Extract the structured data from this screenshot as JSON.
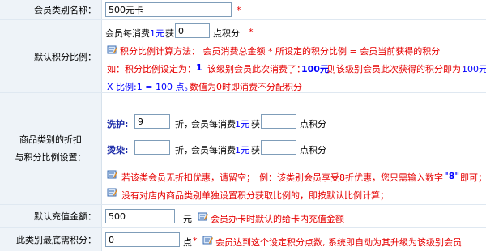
{
  "row1": {
    "label": "会员类别名称：",
    "value": "500元卡",
    "star": "*"
  },
  "row2": {
    "label": "默认积分比例：",
    "text_prefix": "会员每消费",
    "link": "1元",
    "text_mid": "获",
    "value": "0",
    "text_suffix": "点积分",
    "star": "*",
    "line1": "积分比例计算方法： 会员消费总金额 * 所设定的积分比例 = 会员当前获得的积分",
    "line2_a": "如：积分比例设定为：",
    "line2_b": "1",
    "line2_c": "该级别会员此次消费了：",
    "line2_d": "100元",
    "line2_e": "则该级别会员此次获得的积分即为：",
    "line2_f": "100元",
    "line3_a": "X 比例:1 = 100 点。",
    "line3_b": "数值为0时即消费不分配积分"
  },
  "row3": {
    "label_line1": "商品类别的折扣",
    "label_line2": "与积分比例设置：",
    "cat1_name": "洗护:",
    "cat1_discount": "9",
    "cat1_zhe": "折，",
    "cat1_text": "会员每消费",
    "cat1_link": "1元",
    "cat1_get": "获",
    "cat1_points": "",
    "cat1_unit": "点积分",
    "cat2_name": "烫染:",
    "cat2_discount": "",
    "cat2_zhe": "折，",
    "cat2_text": "会员每消费",
    "cat2_link": "1元",
    "cat2_get": "获",
    "cat2_points": "",
    "cat2_unit": "点积分",
    "tip1_a": "若该类会员无折扣优惠，请留空；",
    "tip1_b": "例：该类别会员享受8折优惠，您只需输入数字",
    "tip1_c": "\"8\"",
    "tip1_d": "即可；",
    "tip2": "没有对店内商品类别单独设置积分获取比例的，即按默认比例计算；"
  },
  "row4": {
    "label": "默认充值金额：",
    "value": "500",
    "unit": "元",
    "tip": "会员办卡时默认的给卡内充值金额"
  },
  "row5": {
    "label": "此类别最底需积分：",
    "value": "0",
    "unit": "点",
    "star": "*",
    "tip": "会员达到这个设定积分点数, 系统即自动为其升级为该级别会员"
  },
  "icon": "note-pencil-icon"
}
